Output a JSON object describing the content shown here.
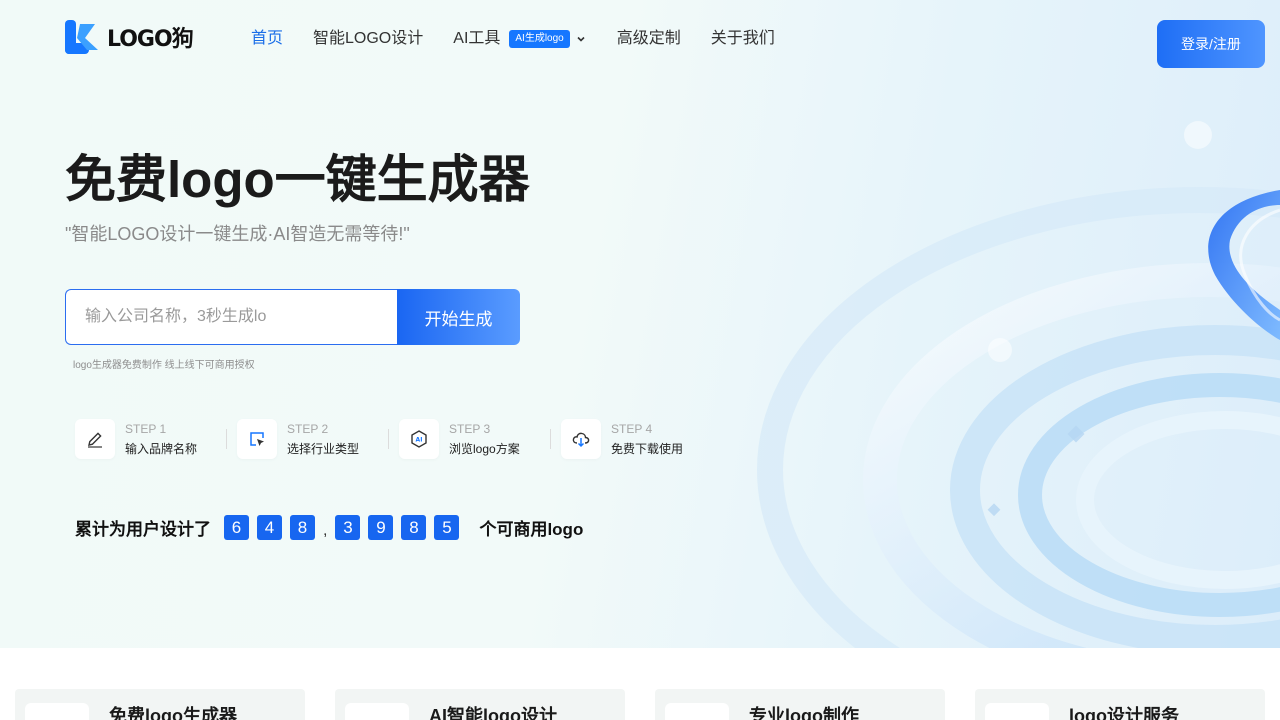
{
  "brand": {
    "logo_text": "LOGO狗"
  },
  "nav": {
    "items": [
      {
        "label": "首页",
        "active": true
      },
      {
        "label": "智能LOGO设计"
      },
      {
        "label": "AI工具",
        "badge": "AI生成logo",
        "dropdown": true
      },
      {
        "label": "高级定制"
      },
      {
        "label": "关于我们"
      }
    ],
    "login_label": "登录/注册"
  },
  "hero": {
    "title": "免费logo一键生成器",
    "subtitle": "\"智能LOGO设计一键生成·AI智造无需等待!\"",
    "search": {
      "placeholder": "输入公司名称，3秒生成lo",
      "value": "",
      "button_label": "开始生成"
    },
    "hint": "logo生成器免费制作 线上线下可商用授权"
  },
  "steps": [
    {
      "num": "STEP 1",
      "label": "输入品牌名称",
      "icon": "pencil-icon"
    },
    {
      "num": "STEP 2",
      "label": "选择行业类型",
      "icon": "cursor-select-icon"
    },
    {
      "num": "STEP 3",
      "label": "浏览logo方案",
      "icon": "ai-hexagon-icon"
    },
    {
      "num": "STEP 4",
      "label": "免费下载使用",
      "icon": "cloud-download-icon"
    }
  ],
  "counter": {
    "prefix": "累计为用户设计了",
    "digits": [
      "6",
      "4",
      "8",
      "3",
      "9",
      "8",
      "5"
    ],
    "separator": ",",
    "suffix": "个可商用logo"
  },
  "cards": [
    {
      "title": "免费logo生成器"
    },
    {
      "title": "AI智能logo设计"
    },
    {
      "title": "专业logo制作"
    },
    {
      "title": "logo设计服务"
    }
  ],
  "colors": {
    "accent": "#1677ff",
    "digit_bg": "#1766f0",
    "active_nav": "#1a6ee8"
  }
}
